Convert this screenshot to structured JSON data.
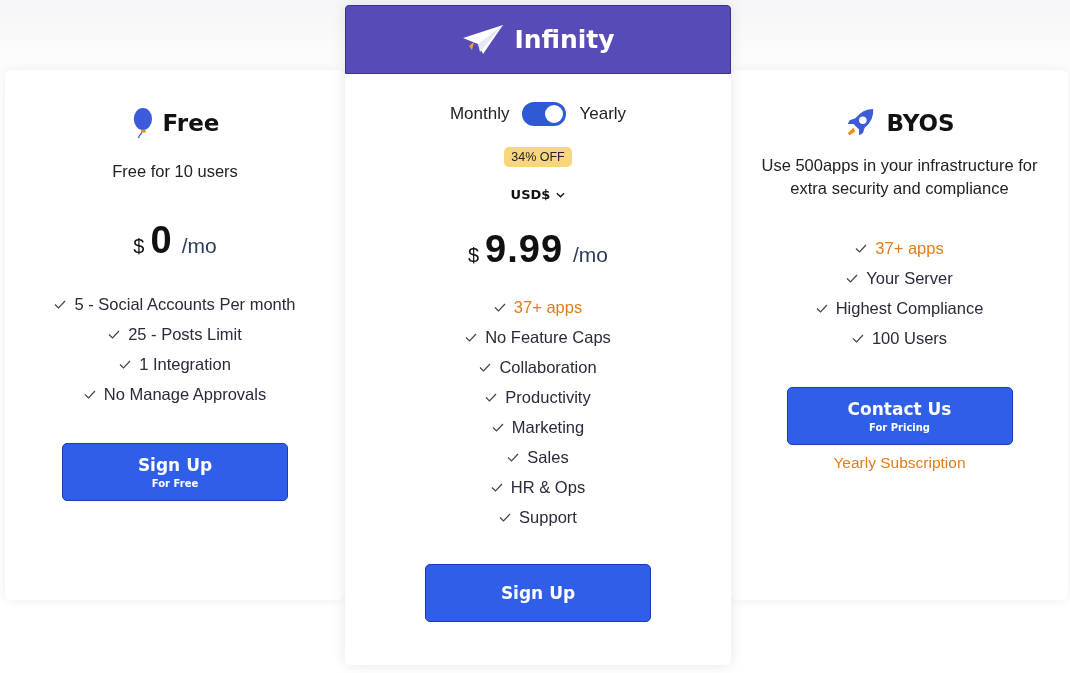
{
  "plans": [
    {
      "name": "Free",
      "featured": false,
      "description": "Free for 10 users",
      "price": {
        "currency": "$",
        "amount": "0",
        "period": "/mo"
      },
      "features": [
        {
          "text": "5 - Social Accounts Per month",
          "highlighted": false
        },
        {
          "text": "25 - Posts Limit",
          "highlighted": false
        },
        {
          "text": "1 Integration",
          "highlighted": false
        },
        {
          "text": "No Manage Approvals",
          "highlighted": false
        }
      ],
      "button": {
        "label": "Sign Up",
        "sublabel": "For Free"
      }
    },
    {
      "name": "Infinity",
      "featured": true,
      "toggle": {
        "left_label": "Monthly",
        "right_label": "Yearly",
        "on": true
      },
      "badge": "34% OFF",
      "currency_select": "USD$",
      "price": {
        "currency": "$",
        "amount": "9.99",
        "period": "/mo"
      },
      "features": [
        {
          "text": "37+ apps",
          "highlighted": true
        },
        {
          "text": "No Feature Caps",
          "highlighted": false
        },
        {
          "text": "Collaboration",
          "highlighted": false
        },
        {
          "text": "Productivity",
          "highlighted": false
        },
        {
          "text": "Marketing",
          "highlighted": false
        },
        {
          "text": "Sales",
          "highlighted": false
        },
        {
          "text": "HR & Ops",
          "highlighted": false
        },
        {
          "text": "Support",
          "highlighted": false
        }
      ],
      "button": {
        "label": "Sign Up"
      }
    },
    {
      "name": "BYOS",
      "featured": false,
      "description": "Use 500apps in your infrastructure for extra security and compliance",
      "features": [
        {
          "text": "37+ apps",
          "highlighted": true
        },
        {
          "text": "Your Server",
          "highlighted": false
        },
        {
          "text": "Highest Compliance",
          "highlighted": false
        },
        {
          "text": "100 Users",
          "highlighted": false
        }
      ],
      "button": {
        "label": "Contact Us",
        "sublabel": "For Pricing"
      },
      "note": "Yearly Subscription"
    }
  ]
}
